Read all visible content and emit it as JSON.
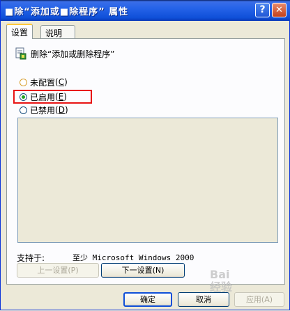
{
  "window": {
    "title": "■除“添加或■除程序” 属性",
    "help_glyph": "?",
    "close_glyph": "✕"
  },
  "tabs": [
    {
      "label": "设置",
      "active": true
    },
    {
      "label": "说明",
      "active": false
    }
  ],
  "policy": {
    "icon": "policy-setting-icon",
    "name": "删除“添加或删除程序”"
  },
  "options": [
    {
      "label": "未配置",
      "accel": "C",
      "checked": false
    },
    {
      "label": "已启用",
      "accel": "E",
      "checked": true
    },
    {
      "label": "已禁用",
      "accel": "D",
      "checked": false
    }
  ],
  "support": {
    "label": "支持于:",
    "value": "至少 Microsoft Windows 2000"
  },
  "nav": {
    "prev_label": "上一设置(P)",
    "next_label": "下一设置(N)"
  },
  "dialog_buttons": {
    "ok": "确定",
    "cancel": "取消",
    "apply": "应用(A)"
  },
  "watermark": {
    "line1": "Bai",
    "line2": "经验"
  },
  "colors": {
    "titlebar": "#2563e8",
    "highlight": "#e81414",
    "radio_checked": "#21a121"
  }
}
